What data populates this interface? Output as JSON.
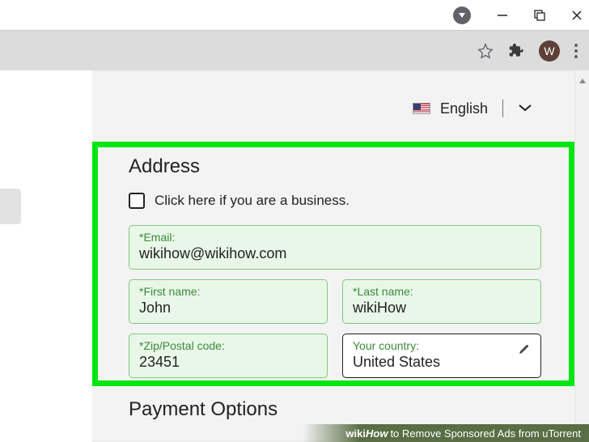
{
  "titlebar": {
    "avatar_inner": "▼"
  },
  "toolbar": {
    "avatar_letter": "W"
  },
  "language": {
    "label": "English"
  },
  "form": {
    "section_title": "Address",
    "business_checkbox_label": "Click here if you are a business.",
    "email_label": "Email:",
    "email_value": "wikihow@wikihow.com",
    "first_name_label": "First name:",
    "first_name_value": "John",
    "last_name_label": "Last name:",
    "last_name_value": "wikiHow",
    "zip_label": "Zip/Postal code:",
    "zip_value": "23451",
    "country_label": "Your country:",
    "country_value": "United States",
    "payment_title": "Payment Options"
  },
  "banner": {
    "wiki": "wiki",
    "how": "How",
    "text": " to Remove Sponsored Ads from uTorrent"
  }
}
